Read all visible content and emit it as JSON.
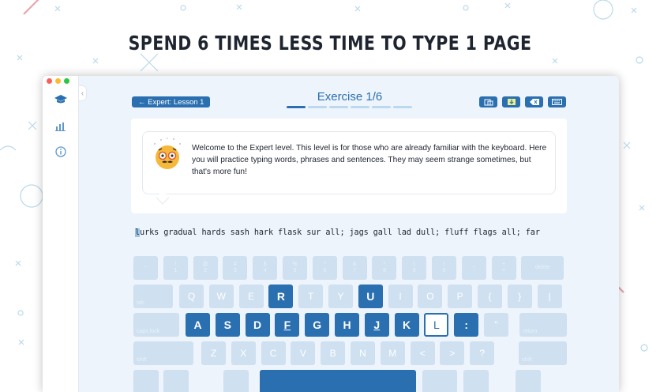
{
  "headline": "SPEND 6 TIMES LESS TIME TO TYPE 1 PAGE",
  "colors": {
    "accent": "#2a6fb0",
    "key_inactive": "#cfe0f0",
    "bg": "#eef4fb"
  },
  "sidebar": {
    "icons": [
      "graduation-cap-icon",
      "bar-chart-icon",
      "info-icon"
    ]
  },
  "header": {
    "back_label": "← Expert: Lesson 1",
    "title": "Exercise 1/6",
    "progress": {
      "current": 1,
      "total": 6
    },
    "tools": [
      "cards-icon",
      "download-icon",
      "backspace-icon",
      "keyboard-icon"
    ]
  },
  "message": {
    "text": "Welcome to the Expert level. This level is for those who are already familiar with the keyboard. Here you will practice typing words, phrases and sentences. They may seem strange sometimes, but that's more fun!"
  },
  "exercise": {
    "cursor_char": "l",
    "rest_text": "urks gradual hards sash hark flask sur all; jags gall lad dull; fluff flags all; far"
  },
  "keyboard": {
    "row1": [
      {
        "main": "",
        "sub": "~"
      },
      {
        "main": "",
        "sub": "!\n1"
      },
      {
        "main": "",
        "sub": "@\n2"
      },
      {
        "main": "",
        "sub": "#\n3"
      },
      {
        "main": "",
        "sub": "$\n4"
      },
      {
        "main": "",
        "sub": "%\n5"
      },
      {
        "main": "",
        "sub": "^\n6"
      },
      {
        "main": "",
        "sub": "&\n7"
      },
      {
        "main": "",
        "sub": "*\n8"
      },
      {
        "main": "",
        "sub": "(\n9"
      },
      {
        "main": "",
        "sub": ")\n0"
      },
      {
        "main": "",
        "sub": "_\n-"
      },
      {
        "main": "",
        "sub": "+\n="
      },
      {
        "main": "",
        "sub": "delete"
      }
    ],
    "row2": [
      "tab",
      "Q",
      "W",
      "E",
      "R",
      "T",
      "Y",
      "U",
      "I",
      "O",
      "P",
      "{",
      "}",
      "|"
    ],
    "row3": [
      "caps lock",
      "A",
      "S",
      "D",
      "F",
      "G",
      "H",
      "J",
      "K",
      "L",
      ":",
      "\"",
      "return"
    ],
    "row4": [
      "shift",
      "Z",
      "X",
      "C",
      "V",
      "B",
      "N",
      "M",
      "<",
      ">",
      "?",
      "shift"
    ],
    "active_keys": [
      "R",
      "U",
      "A",
      "S",
      "D",
      "F",
      "G",
      "H",
      "J",
      "K",
      ":"
    ],
    "next_key": "L",
    "homing_keys": [
      "F",
      "J"
    ]
  }
}
